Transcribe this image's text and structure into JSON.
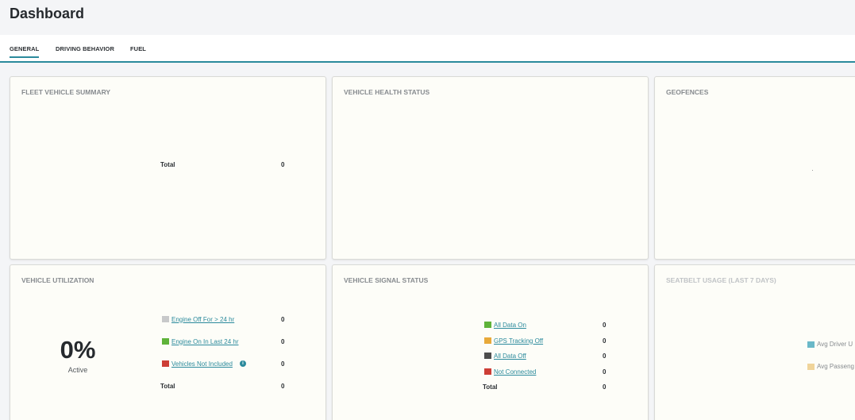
{
  "header": {
    "title": "Dashboard"
  },
  "tabs": [
    {
      "label": "GENERAL",
      "active": true
    },
    {
      "label": "DRIVING BEHAVIOR",
      "active": false
    },
    {
      "label": "FUEL",
      "active": false
    }
  ],
  "colors": {
    "accent": "#2b8a9c",
    "engine_off": "#c8c9ca",
    "engine_on": "#5fb33a",
    "not_included": "#cd3e36",
    "all_data_on": "#5fb33a",
    "gps_off": "#e8a93a",
    "all_data_off": "#4d4d4d",
    "not_connected": "#cd3e36",
    "avg_driver": "#6ab8c8",
    "avg_passenger": "#f0d49a"
  },
  "fleet_summary": {
    "title": "FLEET VEHICLE SUMMARY",
    "total_label": "Total",
    "total_value": "0"
  },
  "vehicle_health": {
    "title": "VEHICLE HEALTH STATUS"
  },
  "geofences": {
    "title": "GEOFENCES"
  },
  "utilization": {
    "title": "VEHICLE UTILIZATION",
    "percent": "0%",
    "sub": "Active",
    "rows": [
      {
        "label": "Engine Off For > 24 hr",
        "value": "0"
      },
      {
        "label": "Engine On In Last 24 hr",
        "value": "0"
      },
      {
        "label": "Vehicles Not Included",
        "value": "0",
        "info_icon": "info-icon"
      }
    ],
    "total_label": "Total",
    "total_value": "0"
  },
  "signal_status": {
    "title": "VEHICLE SIGNAL STATUS",
    "rows": [
      {
        "label": "All Data On",
        "value": "0"
      },
      {
        "label": "GPS Tracking Off",
        "value": "0"
      },
      {
        "label": "All Data Off",
        "value": "0"
      },
      {
        "label": "Not Connected",
        "value": "0"
      }
    ],
    "total_label": "Total",
    "total_value": "0"
  },
  "seatbelt": {
    "title": "SEATBELT USAGE (LAST 7 DAYS)",
    "legend": [
      "Avg Driver U",
      "Avg Passeng"
    ]
  }
}
